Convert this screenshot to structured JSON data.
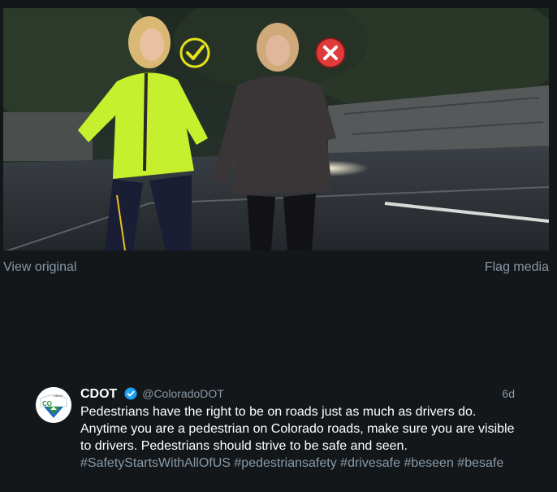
{
  "media": {
    "alt_icons": [
      "checkmark-icon",
      "x-mark-icon"
    ],
    "colors": {
      "check": "#e6e21a",
      "cross": "#e03a3a",
      "hi_vis_jacket": "#c6f02e",
      "dark_jacket": "#3a3536"
    }
  },
  "media_actions": {
    "view_original": "View original",
    "flag_media": "Flag media"
  },
  "tweet": {
    "author_name": "CDOT",
    "verified_icon": "verified-badge-icon",
    "handle": "@ColoradoDOT",
    "time": "6d",
    "text": "Pedestrians have the right to be on roads just as much as drivers do. Anytime you are a pedestrian on Colorado roads, make sure you are visible to drivers. Pedestrians should strive to be safe and seen.",
    "hashtags": [
      "#SafetyStartsWithAllOfUS",
      "#pedestriansafety",
      "#drivesafe",
      "#beseen",
      "#besafe"
    ],
    "avatar_text": "CO",
    "avatar_label": "CDOT"
  }
}
